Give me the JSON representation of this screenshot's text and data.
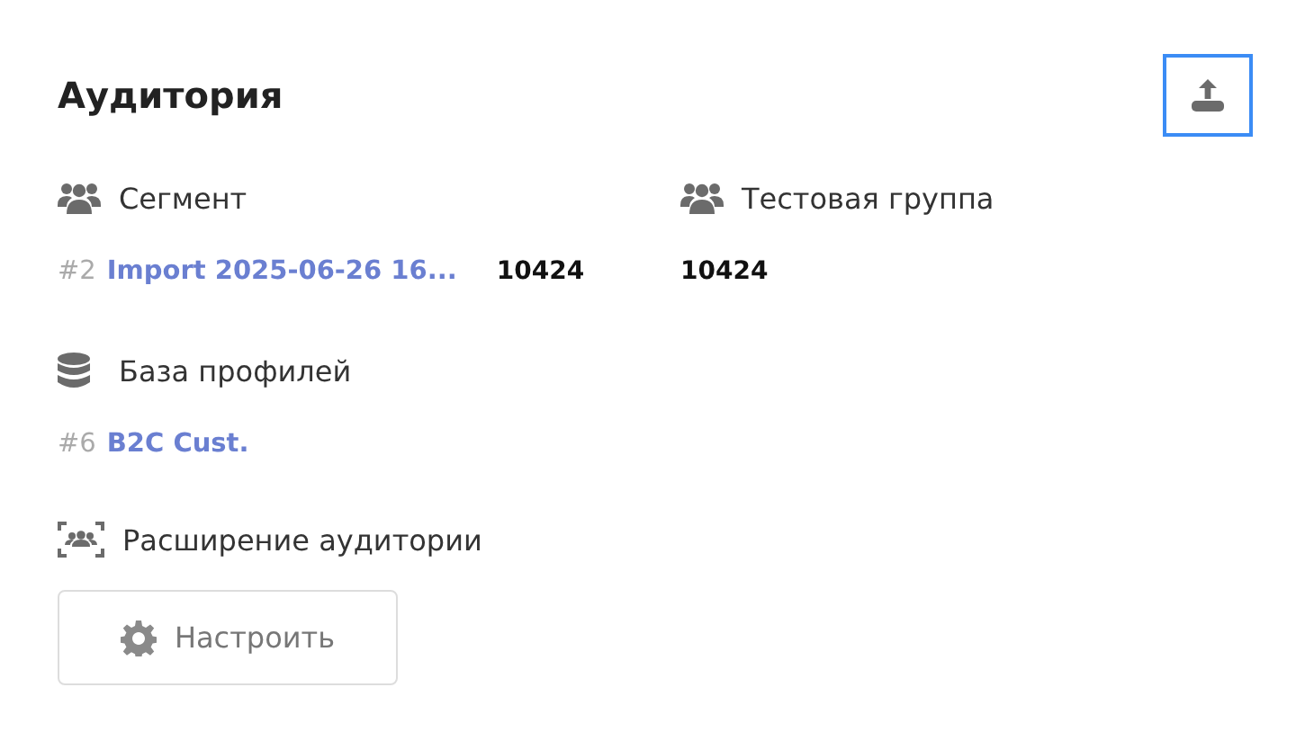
{
  "title": "Аудитория",
  "export_button": {
    "focused": true
  },
  "segment": {
    "label": "Сегмент",
    "id": "#2",
    "name": "Import 2025-06-26 16...",
    "count": "10424"
  },
  "test_group": {
    "label": "Тестовая группа",
    "count": "10424"
  },
  "profile_base": {
    "label": "База профилей",
    "id": "#6",
    "name": "B2C Cust."
  },
  "expansion": {
    "label": "Расширение аудитории",
    "button": "Настроить"
  }
}
